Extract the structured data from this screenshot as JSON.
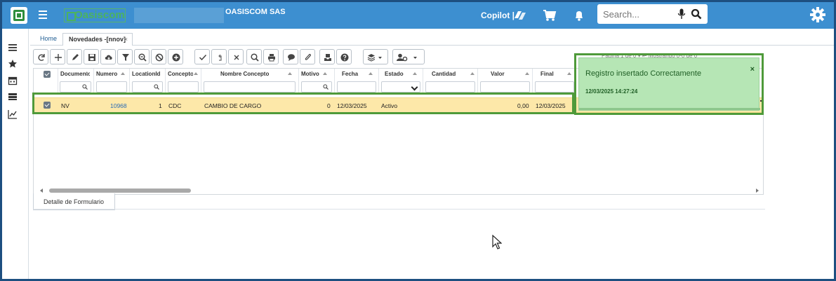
{
  "header": {
    "logo_text": "Oasiscom",
    "company": "OASISCOM SAS",
    "copilot_label": "Copilot |",
    "search_placeholder": "Search..."
  },
  "tabs": {
    "home": "Home",
    "active": "Novedades -[nnov]",
    "close": "×"
  },
  "grid": {
    "columns": [
      "Documento",
      "Numero",
      "LocationId",
      "Concepto",
      "Nombre Concepto",
      "Motivo",
      "Fecha",
      "Estado",
      "Cantidad",
      "Valor",
      "Final"
    ],
    "row": {
      "documento": "NV",
      "numero": "10968",
      "location": "1",
      "concepto": "CDC",
      "nombre": "CAMBIO DE CARGO",
      "motivo": "0",
      "fecha": "12/03/2025",
      "estado": "Activo",
      "cantidad": "",
      "valor": "0,00",
      "final": "12/03/2025"
    }
  },
  "pager": "Pagina 1 de 0 ▾ ⇤ Mostrando 0-0 de 0",
  "toast": {
    "title": "Registro insertado Correctamente",
    "timestamp": "12/03/2025 14:27:24",
    "close": "×"
  },
  "detail_tab": "Detalle de Formulario",
  "colors": {
    "topbar": "#3d8fd0",
    "row_selected": "#fde8a9",
    "toast_bg": "#b6e6b5",
    "highlight": "#4f9a3a"
  }
}
